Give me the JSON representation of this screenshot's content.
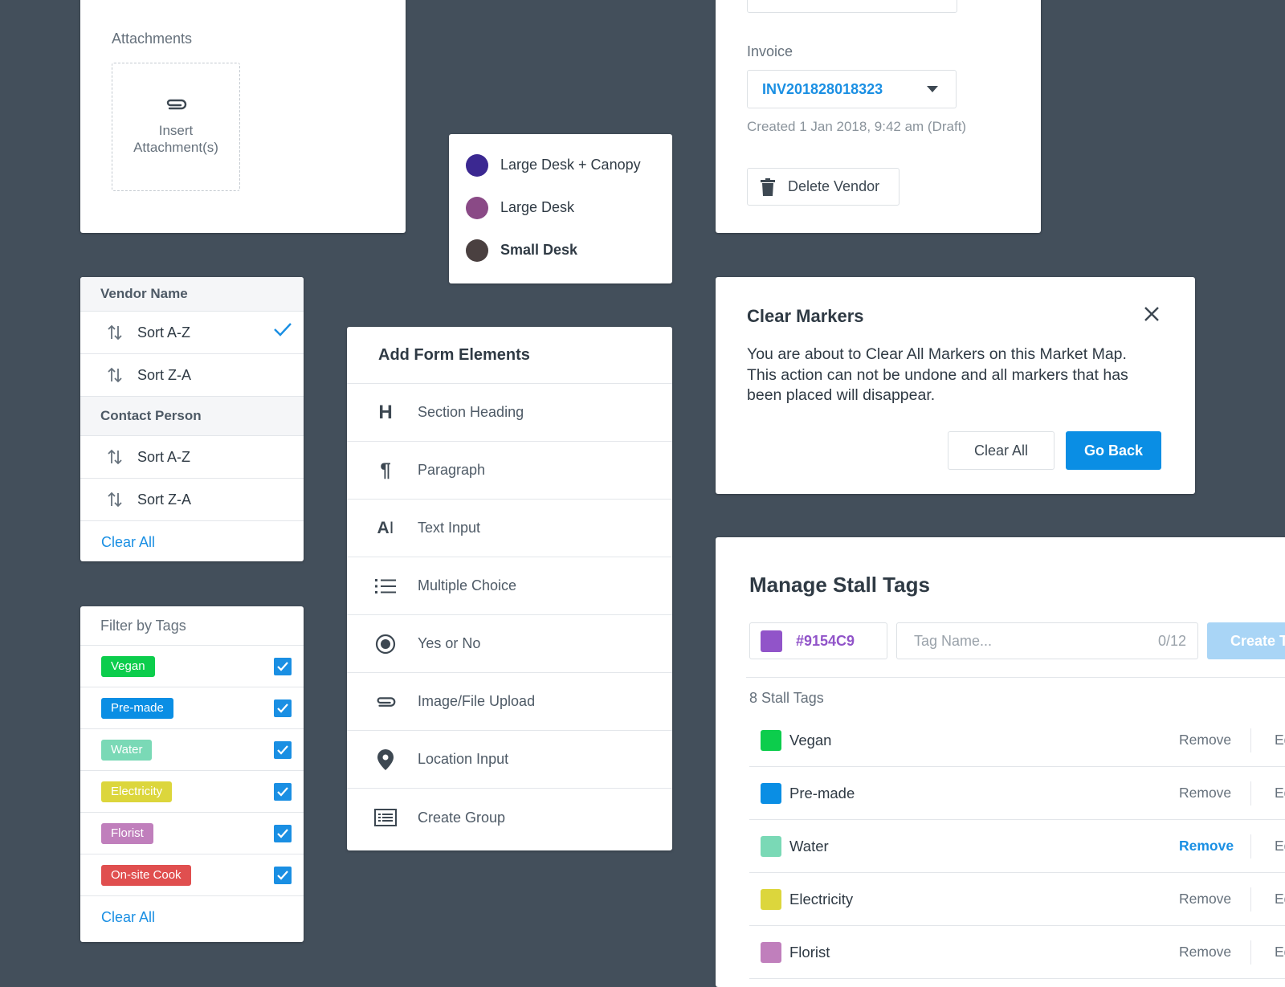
{
  "attachments": {
    "label": "Attachments",
    "insert_line1": "Insert",
    "insert_line2": "Attachment(s)"
  },
  "desks": [
    {
      "label": "Large Desk + Canopy",
      "color": "#3b2891"
    },
    {
      "label": "Large Desk",
      "color": "#8a4a86"
    },
    {
      "label": "Small Desk",
      "color": "#4a4040"
    }
  ],
  "invoice": {
    "label": "Invoice",
    "value": "INV201828018323",
    "meta": "Created 1 Jan 2018, 9:42 am (Draft)",
    "delete_label": "Delete Vendor"
  },
  "vendor_sort": {
    "section1": "Vendor Name",
    "section2": "Contact Person",
    "sort_az": "Sort A-Z",
    "sort_za": "Sort Z-A",
    "clear_all": "Clear All"
  },
  "filter": {
    "title": "Filter by Tags",
    "tags": [
      {
        "label": "Vegan",
        "color": "#0ccd4c"
      },
      {
        "label": "Pre-made",
        "color": "#0a8ee4"
      },
      {
        "label": "Water",
        "color": "#7ad9b6"
      },
      {
        "label": "Electricity",
        "color": "#dcd63c"
      },
      {
        "label": "Florist",
        "color": "#c07fbc"
      },
      {
        "label": "On-site Cook",
        "color": "#e04f4f"
      }
    ],
    "clear_all": "Clear All"
  },
  "form_elements": {
    "title": "Add Form Elements",
    "items": [
      {
        "label": "Section Heading",
        "icon": "heading-icon"
      },
      {
        "label": "Paragraph",
        "icon": "paragraph-icon"
      },
      {
        "label": "Text Input",
        "icon": "text-input-icon"
      },
      {
        "label": "Multiple Choice",
        "icon": "list-icon"
      },
      {
        "label": "Yes or No",
        "icon": "radio-icon"
      },
      {
        "label": "Image/File Upload",
        "icon": "paperclip-icon"
      },
      {
        "label": "Location Input",
        "icon": "location-pin-icon"
      },
      {
        "label": "Create Group",
        "icon": "group-icon"
      }
    ]
  },
  "modal": {
    "title": "Clear Markers",
    "body": "You are about to Clear All Markers on this Market Map. This action can not be undone and all markers that has been placed will disappear.",
    "clear_all": "Clear All",
    "go_back": "Go Back"
  },
  "stall_tags": {
    "title": "Manage Stall Tags",
    "color_value": "#9154C9",
    "name_placeholder": "Tag Name...",
    "char_count": "0/12",
    "create_label": "Create Tag",
    "count_label": "8 Stall Tags",
    "remove_label": "Remove",
    "edit_label": "Edit",
    "items": [
      {
        "label": "Vegan",
        "color": "#0ccd4c"
      },
      {
        "label": "Pre-made",
        "color": "#0a8ee4"
      },
      {
        "label": "Water",
        "color": "#7ad9b6"
      },
      {
        "label": "Electricity",
        "color": "#dcd63c"
      },
      {
        "label": "Florist",
        "color": "#c07fbc"
      }
    ]
  }
}
